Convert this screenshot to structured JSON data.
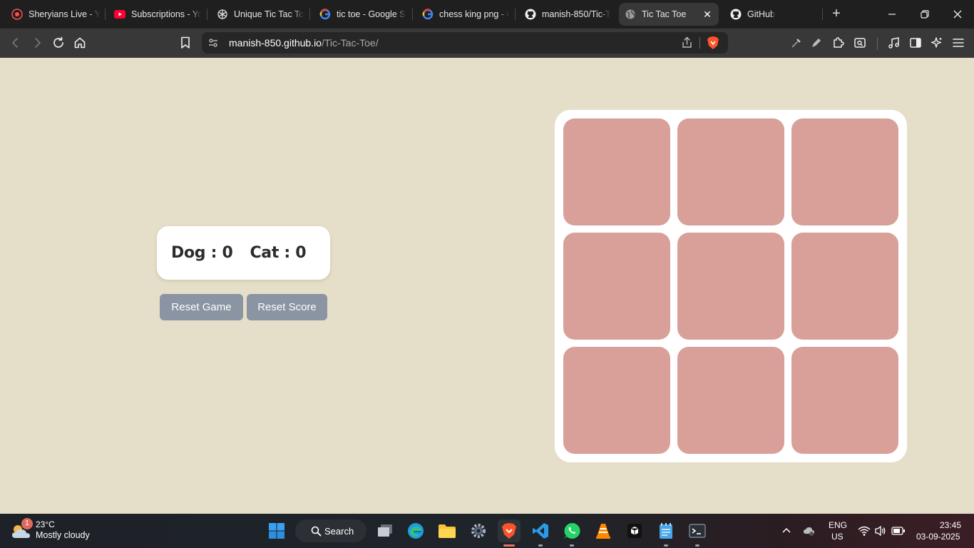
{
  "tabs": [
    {
      "title": "Sheryians Live - Yo",
      "icon": "sheryians-icon"
    },
    {
      "title": "Subscriptions - Yo",
      "icon": "youtube-icon"
    },
    {
      "title": "Unique Tic Tac Toe",
      "icon": "chatgpt-icon"
    },
    {
      "title": "tic toe - Google S",
      "icon": "google-icon"
    },
    {
      "title": "chess king png - G",
      "icon": "google-icon"
    },
    {
      "title": "manish-850/Tic-Ta",
      "icon": "github-icon"
    },
    {
      "title": "Tic Tac Toe",
      "icon": "globe-icon",
      "active": true
    },
    {
      "title": "GitHub",
      "icon": "github-icon"
    }
  ],
  "address": {
    "host": "manish-850.github.io",
    "path": "/Tic-Tac-Toe/"
  },
  "game": {
    "scores": [
      {
        "player": "Dog",
        "value": 0
      },
      {
        "player": "Cat",
        "value": 0
      }
    ],
    "score_texts": [
      "Dog : 0",
      "Cat : 0"
    ],
    "reset_game_label": "Reset Game",
    "reset_score_label": "Reset Score",
    "cells": [
      "",
      "",
      "",
      "",
      "",
      "",
      "",
      "",
      ""
    ]
  },
  "colors": {
    "page_bg": "#e5dec8",
    "cell": "#d8a099",
    "board": "#ffffff",
    "button": "#8a94a3"
  },
  "taskbar": {
    "weather_badge": "1",
    "temperature": "23°C",
    "condition": "Mostly cloudy",
    "search_label": "Search",
    "lang_primary": "ENG",
    "lang_secondary": "US",
    "time": "23:45",
    "date": "03-09-2025"
  }
}
